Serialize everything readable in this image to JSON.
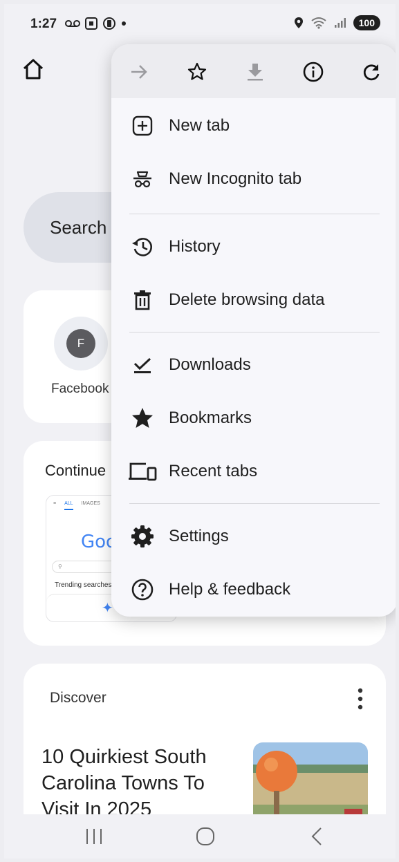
{
  "status_bar": {
    "time": "1:27",
    "battery": "100",
    "icons": [
      "voicemail-icon",
      "screenshot-icon",
      "media-icon",
      "dot-icon",
      "location-icon",
      "wifi-icon",
      "signal-icon"
    ]
  },
  "page": {
    "search_placeholder": "Search",
    "shortcut": {
      "initial": "F",
      "label": "Facebook"
    },
    "continue_title": "Continue",
    "thumbnail": {
      "tab_all": "ALL",
      "tab_images": "IMAGES",
      "logo": "Goo",
      "trending": "Trending searches"
    },
    "discover_label": "Discover",
    "article_title": "10 Quirkiest South Carolina Towns To Visit In 2025"
  },
  "menu": {
    "toolbar": [
      "forward-icon",
      "bookmark-star-icon",
      "download-icon",
      "info-icon",
      "reload-icon"
    ],
    "items": [
      {
        "label": "New tab",
        "icon": "new-tab-icon"
      },
      {
        "label": "New Incognito tab",
        "icon": "incognito-icon"
      },
      {
        "label": "History",
        "icon": "history-icon"
      },
      {
        "label": "Delete browsing data",
        "icon": "trash-icon"
      },
      {
        "label": "Downloads",
        "icon": "downloads-icon"
      },
      {
        "label": "Bookmarks",
        "icon": "star-icon"
      },
      {
        "label": "Recent tabs",
        "icon": "devices-icon"
      },
      {
        "label": "Settings",
        "icon": "gear-icon"
      },
      {
        "label": "Help & feedback",
        "icon": "help-icon"
      }
    ]
  },
  "colors": {
    "background": "#f1f1f5",
    "menu_background": "#f7f7fb",
    "toolbar_background": "#ececf0",
    "search_pill": "#dfe1e8",
    "accent_blue": "#1a73e8"
  }
}
